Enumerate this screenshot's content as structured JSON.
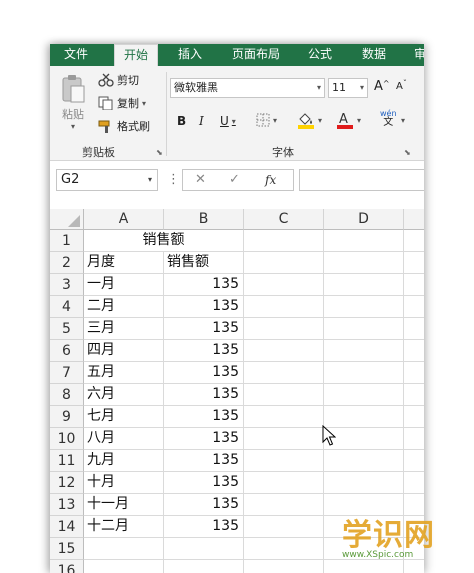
{
  "ribbon": {
    "tabs": [
      "文件",
      "开始",
      "插入",
      "页面布局",
      "公式",
      "数据",
      "审"
    ],
    "clipboard": {
      "paste": "粘贴",
      "cut": "剪切",
      "copy": "复制",
      "format_painter": "格式刷",
      "group_label": "剪贴板"
    },
    "font": {
      "name": "微软雅黑",
      "size": "11",
      "group_label": "字体",
      "bold": "B",
      "italic": "I",
      "underline": "U",
      "grow": "A",
      "shrink": "A",
      "font_color": "A",
      "wen": "wén",
      "wen_char": "文"
    }
  },
  "formula_bar": {
    "name_box": "G2",
    "cancel": "✕",
    "enter": "✓",
    "fx": "fx",
    "value": "",
    "dots": "⋮"
  },
  "sheet": {
    "columns": [
      "A",
      "B",
      "C",
      "D"
    ],
    "rows": [
      "1",
      "2",
      "3",
      "4",
      "5",
      "6",
      "7",
      "8",
      "9",
      "10",
      "11",
      "12",
      "13",
      "14",
      "15",
      "16"
    ],
    "title": "销售额",
    "header": {
      "month": "月度",
      "sales": "销售额"
    },
    "data": [
      {
        "month": "一月",
        "sales": "135"
      },
      {
        "month": "二月",
        "sales": "135"
      },
      {
        "month": "三月",
        "sales": "135"
      },
      {
        "month": "四月",
        "sales": "135"
      },
      {
        "month": "五月",
        "sales": "135"
      },
      {
        "month": "六月",
        "sales": "135"
      },
      {
        "month": "七月",
        "sales": "135"
      },
      {
        "month": "八月",
        "sales": "135"
      },
      {
        "month": "九月",
        "sales": "135"
      },
      {
        "month": "十月",
        "sales": "135"
      },
      {
        "month": "十一月",
        "sales": "135"
      },
      {
        "month": "十二月",
        "sales": "135"
      }
    ]
  },
  "watermark": {
    "text": "学识网",
    "url": "www.XSpic.com"
  },
  "colors": {
    "accent": "#217346",
    "font_fill": "#ffd200",
    "font_color": "#e01b1b"
  }
}
